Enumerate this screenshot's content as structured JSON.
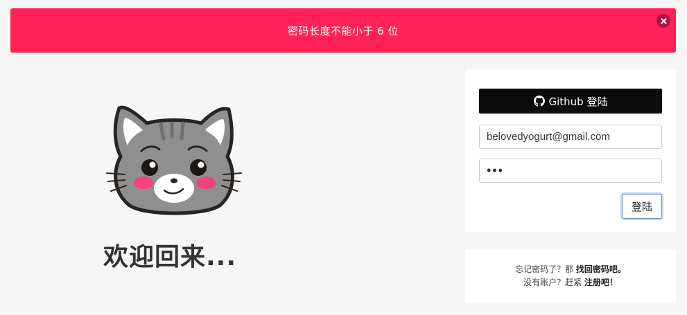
{
  "alert": {
    "message": "密码长度不能小于 6 位",
    "close_symbol": "✕",
    "background_color": "#ff2157"
  },
  "welcome": {
    "logo_icon": "cat-face-icon",
    "title": "欢迎回来..."
  },
  "login": {
    "github_button_label": "Github 登陆",
    "github_icon": "github-icon",
    "email_value": "belovedyogurt@gmail.com",
    "password_masked": "•••",
    "submit_label": "登陆"
  },
  "links": {
    "forgot_prefix": "忘记密码了？那 ",
    "forgot_link": "找回密码吧。",
    "register_prefix": "没有账户？赶紧 ",
    "register_link": "注册吧！"
  }
}
